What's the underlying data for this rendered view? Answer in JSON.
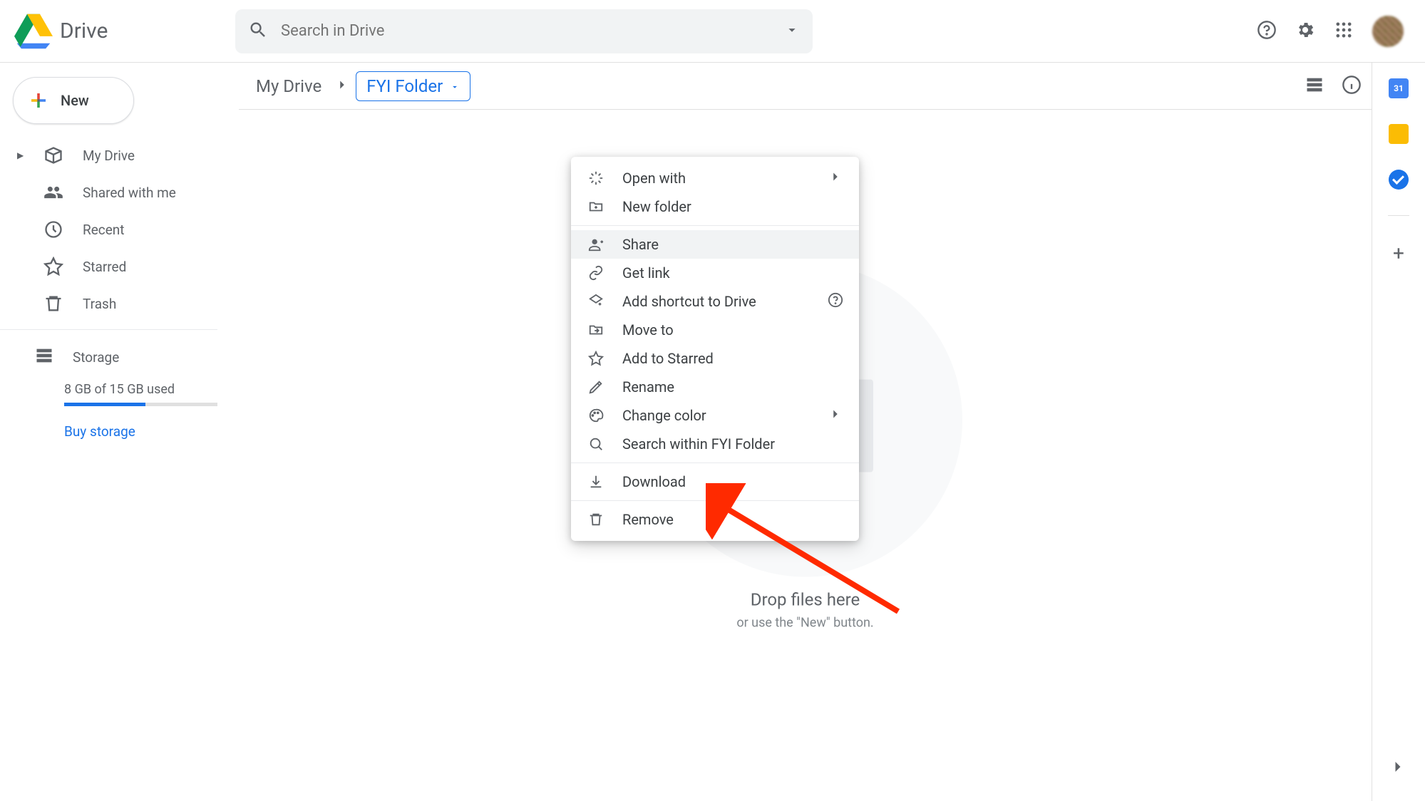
{
  "app": {
    "title": "Drive"
  },
  "search": {
    "placeholder": "Search in Drive"
  },
  "new_button": "New",
  "sidebar": {
    "items": [
      {
        "label": "My Drive",
        "icon": "drive-icon",
        "expandable": true
      },
      {
        "label": "Shared with me",
        "icon": "shared-icon"
      },
      {
        "label": "Recent",
        "icon": "clock-icon"
      },
      {
        "label": "Starred",
        "icon": "star-icon"
      },
      {
        "label": "Trash",
        "icon": "trash-icon"
      }
    ],
    "storage_label": "Storage",
    "storage_text": "8 GB of 15 GB used",
    "storage_used_pct": 53,
    "buy_label": "Buy storage"
  },
  "breadcrumb": {
    "root": "My Drive",
    "current": "FYI Folder"
  },
  "context_menu": {
    "items": [
      {
        "label": "Open with",
        "icon": "open-with-icon",
        "submenu": true
      },
      {
        "label": "New folder",
        "icon": "new-folder-icon"
      },
      {
        "sep": true
      },
      {
        "label": "Share",
        "icon": "person-add-icon",
        "hover": true
      },
      {
        "label": "Get link",
        "icon": "link-icon"
      },
      {
        "label": "Add shortcut to Drive",
        "icon": "shortcut-icon",
        "help": true
      },
      {
        "label": "Move to",
        "icon": "move-icon"
      },
      {
        "label": "Add to Starred",
        "icon": "star-outline-icon"
      },
      {
        "label": "Rename",
        "icon": "pencil-icon"
      },
      {
        "label": "Change color",
        "icon": "palette-icon",
        "submenu": true
      },
      {
        "label": "Search within FYI Folder",
        "icon": "search-in-icon"
      },
      {
        "sep": true
      },
      {
        "label": "Download",
        "icon": "download-icon"
      },
      {
        "sep": true
      },
      {
        "label": "Remove",
        "icon": "trash-outline-icon"
      }
    ]
  },
  "empty": {
    "title": "Drop files here",
    "subtitle": "or use the \"New\" button."
  }
}
